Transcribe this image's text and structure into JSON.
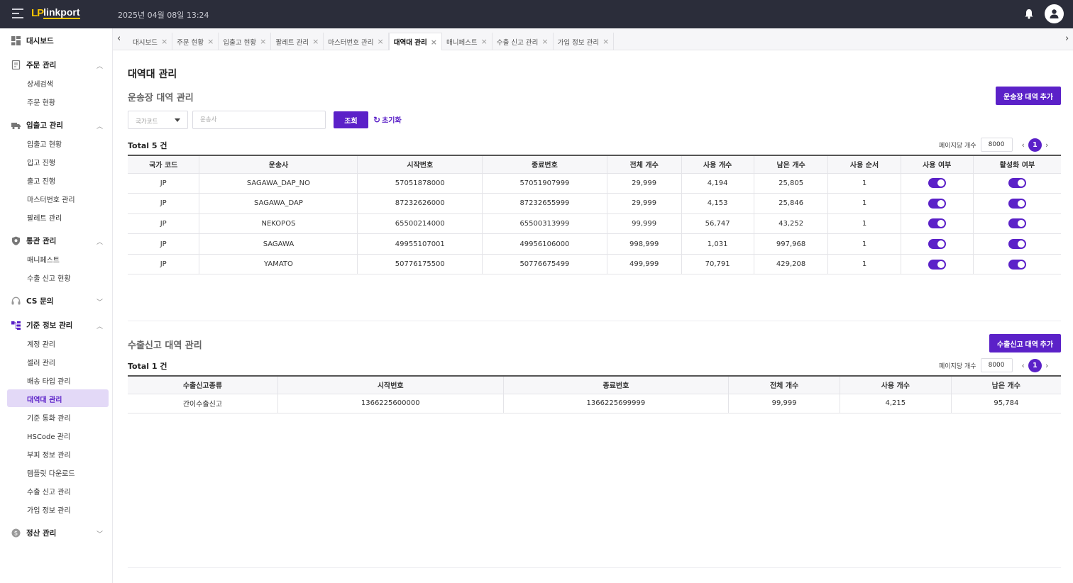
{
  "header": {
    "logo_mark": "LP",
    "logo_text": "linkport",
    "datetime": "2025년 04월 08일 13:24",
    "icons": [
      "menu-collapse-icon",
      "bell-icon",
      "user-icon"
    ]
  },
  "sidebar": {
    "groups": [
      {
        "label": "대시보드",
        "icon": "dashboard-icon"
      },
      {
        "label": "주문 관리",
        "icon": "order-icon",
        "items": [
          "상세검색",
          "주문 현황"
        ]
      },
      {
        "label": "입출고 관리",
        "icon": "truck-icon",
        "items": [
          "입출고 현황",
          "입고 진행",
          "출고 진행",
          "마스터번호 관리",
          "팔레트 관리"
        ]
      },
      {
        "label": "통관 관리",
        "icon": "shield-icon",
        "items": [
          "매니페스트",
          "수출 신고 현황"
        ]
      },
      {
        "label": "CS 문의",
        "icon": "headset-icon"
      },
      {
        "label": "기준 정보 관리",
        "icon": "hierarchy-icon",
        "items": [
          "계정 관리",
          "셀러 관리",
          "배송 타입 관리",
          "대역대 관리",
          "기준 통화 관리",
          "HSCode 관리",
          "부피 정보 관리",
          "템플릿 다운로드",
          "수출 신고 관리",
          "가입 정보 관리"
        ]
      },
      {
        "label": "정산 관리",
        "icon": "dollar-icon"
      }
    ],
    "active_item": "대역대 관리"
  },
  "tabs": [
    "대시보드",
    "주문 현황",
    "입출고 현황",
    "팔레트 관리",
    "마스터번호 관리",
    "대역대 관리",
    "매니페스트",
    "수출 신고 관리",
    "가입 정보 관리"
  ],
  "active_tab": "대역대 관리",
  "page": {
    "title": "대역대 관리"
  },
  "waybill": {
    "section_title": "운송장 대역 관리",
    "add_button": "운송장 대역 추가",
    "filter": {
      "country_placeholder": "국가코드",
      "carrier_placeholder": "운송사",
      "search_button": "조회",
      "reset_button": "초기화"
    },
    "total": "Total 5 건",
    "pager": {
      "label": "페이지당 개수",
      "page_size": "8000",
      "current_page": "1"
    },
    "columns": [
      "국가 코드",
      "운송사",
      "시작번호",
      "종료번호",
      "전체 개수",
      "사용 개수",
      "남은 개수",
      "사용 순서",
      "사용 여부",
      "활성화 여부"
    ],
    "rows": [
      [
        "JP",
        "SAGAWA_DAP_NO",
        "57051878000",
        "57051907999",
        "29,999",
        "4,194",
        "25,805",
        "1"
      ],
      [
        "JP",
        "SAGAWA_DAP",
        "87232626000",
        "87232655999",
        "29,999",
        "4,153",
        "25,846",
        "1"
      ],
      [
        "JP",
        "NEKOPOS",
        "65500214000",
        "65500313999",
        "99,999",
        "56,747",
        "43,252",
        "1"
      ],
      [
        "JP",
        "SAGAWA",
        "49955107001",
        "49956106000",
        "998,999",
        "1,031",
        "997,968",
        "1"
      ],
      [
        "JP",
        "YAMATO",
        "50776175500",
        "50776675499",
        "499,999",
        "70,791",
        "429,208",
        "1"
      ]
    ]
  },
  "export": {
    "section_title": "수출신고 대역 관리",
    "add_button": "수출신고 대역 추가",
    "total": "Total 1 건",
    "pager": {
      "label": "페이지당 개수",
      "page_size": "8000",
      "current_page": "1"
    },
    "columns": [
      "수출신고종류",
      "시작번호",
      "종료번호",
      "전체 개수",
      "사용 개수",
      "남은 개수"
    ],
    "rows": [
      [
        "간이수출신고",
        "1366225600000",
        "1366225699999",
        "99,999",
        "4,215",
        "95,784"
      ]
    ]
  },
  "colors": {
    "accent": "#5b21c8",
    "header_bg": "#2b2d3a",
    "logo_yellow": "#f5c400"
  }
}
